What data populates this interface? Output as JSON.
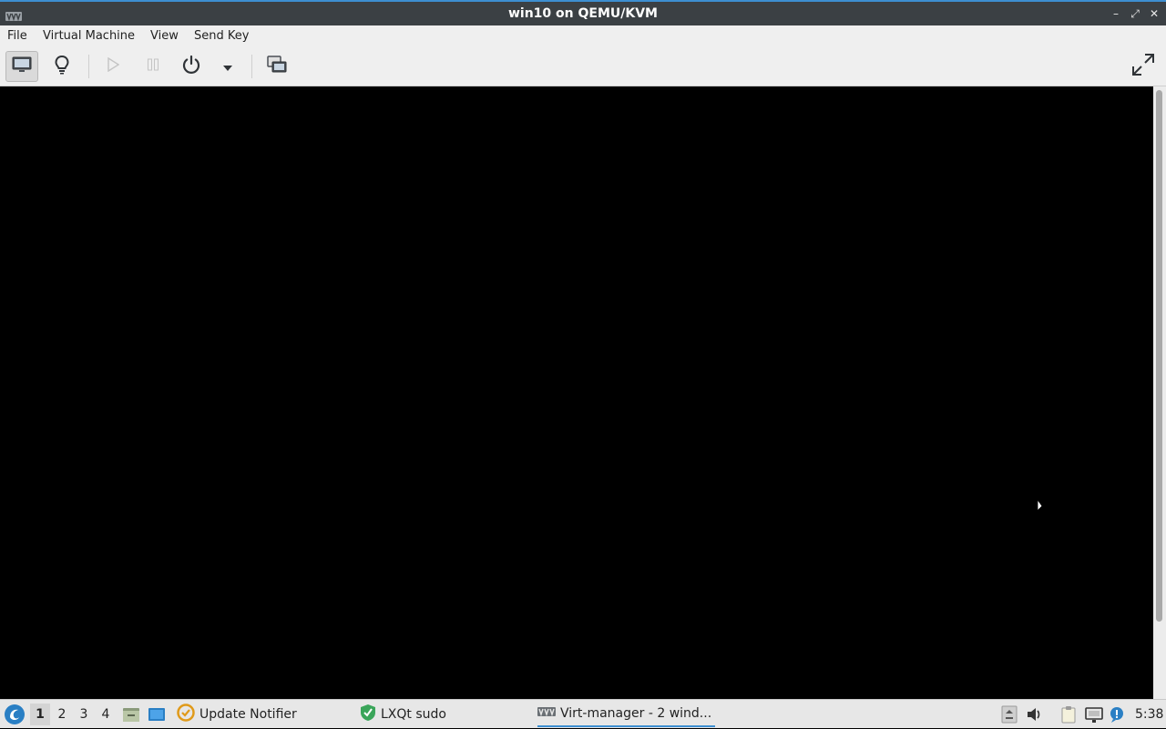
{
  "window": {
    "title": "win10 on QEMU/KVM",
    "app_icon": "virt-manager-icon",
    "controls": {
      "minimize": "–",
      "maximize": "⤢",
      "close": "✕"
    }
  },
  "menubar": {
    "items": [
      {
        "label": "File"
      },
      {
        "label": "Virtual Machine"
      },
      {
        "label": "View"
      },
      {
        "label": "Send Key"
      }
    ]
  },
  "toolbar": {
    "buttons": [
      {
        "name": "console-view",
        "icon": "monitor-icon",
        "active": true
      },
      {
        "name": "details-view",
        "icon": "lightbulb-icon"
      },
      {
        "name": "run",
        "icon": "play-icon",
        "enabled": false
      },
      {
        "name": "pause",
        "icon": "pause-icon",
        "enabled": false
      },
      {
        "name": "shutdown",
        "icon": "power-icon"
      },
      {
        "name": "shutdown-menu",
        "icon": "chevron-down-icon"
      },
      {
        "name": "snapshots",
        "icon": "snapshot-icon"
      },
      {
        "name": "fullscreen",
        "icon": "fullscreen-icon"
      }
    ]
  },
  "console": {
    "background": "#000000"
  },
  "taskbar": {
    "desktops": [
      "1",
      "2",
      "3",
      "4"
    ],
    "current_desktop": "1",
    "quicklaunch": [
      {
        "icon": "file-manager-icon"
      },
      {
        "icon": "show-desktop-icon"
      }
    ],
    "tasks": [
      {
        "label": "Update Notifier",
        "icon": "update-notifier-icon"
      },
      {
        "label": "LXQt sudo",
        "icon": "shield-icon"
      },
      {
        "label": "Virt-manager - 2 wind...",
        "icon": "virt-manager-icon",
        "active": true
      }
    ],
    "tray": [
      {
        "icon": "tray-arrow-icon"
      },
      {
        "icon": "volume-icon"
      },
      {
        "icon": "clipboard-icon"
      },
      {
        "icon": "network-icon"
      },
      {
        "icon": "notification-icon"
      }
    ],
    "clock": "5:38"
  },
  "colors": {
    "titlebar": "#3b4044",
    "accent": "#3d8fd1",
    "chrome": "#efefef",
    "taskbar": "#e7e7e7"
  }
}
